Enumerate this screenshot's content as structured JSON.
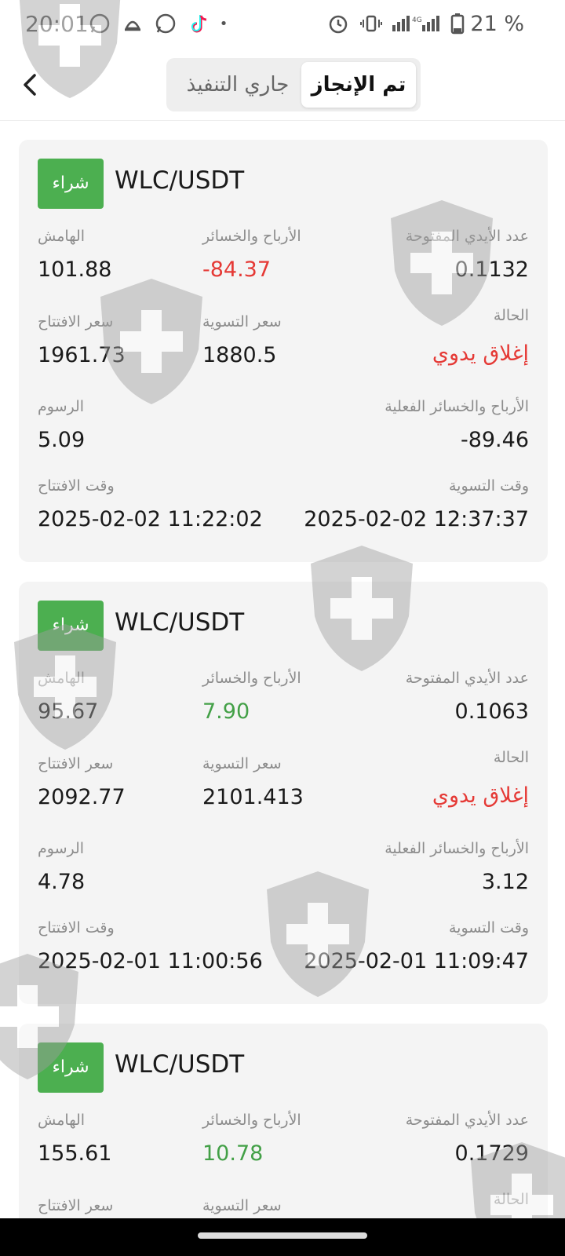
{
  "status_bar": {
    "time": "20:01",
    "battery_percent": "21 %",
    "network": "4G",
    "icons": [
      "whatsapp-icon",
      "notification-icon",
      "whatsapp-icon",
      "tiktok-icon",
      "dot-icon",
      "alarm-icon",
      "vibrate-icon",
      "signal-icon",
      "battery-icon"
    ]
  },
  "header": {
    "tabs": [
      {
        "label": "جاري التنفيذ",
        "active": false
      },
      {
        "label": "تم الإنجاز",
        "active": true
      }
    ]
  },
  "labels": {
    "margin": "الهامش",
    "pnl": "الأرباح والخسائر",
    "open_positions": "عدد الأيدي المفتوحة",
    "open_price": "سعر الافتتاح",
    "settle_price": "سعر التسوية",
    "status": "الحالة",
    "fees": "الرسوم",
    "real_pnl": "الأرباح والخسائر الفعلية",
    "open_time": "وقت الافتتاح",
    "settle_time": "وقت التسوية"
  },
  "trades": [
    {
      "side": "شراء",
      "pair": "WLC/USDT",
      "margin": "101.88",
      "pnl": "-84.37",
      "open_positions": "0.1132",
      "open_price": "1961.73",
      "settle_price": "1880.5",
      "status": "إغلاق يدوي",
      "fees": "5.09",
      "real_pnl": "-89.46",
      "open_time": "2025-02-02 11:22:02",
      "settle_time": "2025-02-02 12:37:37"
    },
    {
      "side": "شراء",
      "pair": "WLC/USDT",
      "margin": "95.67",
      "pnl": "7.90",
      "open_positions": "0.1063",
      "open_price": "2092.77",
      "settle_price": "2101.413",
      "status": "إغلاق يدوي",
      "fees": "4.78",
      "real_pnl": "3.12",
      "open_time": "2025-02-01 11:00:56",
      "settle_time": "2025-02-01 11:09:47"
    },
    {
      "side": "شراء",
      "pair": "WLC/USDT",
      "margin": "155.61",
      "pnl": "10.78",
      "open_positions": "0.1729",
      "open_price": "",
      "settle_price": "",
      "status": "",
      "fees": "",
      "real_pnl": "",
      "open_time": "",
      "settle_time": ""
    }
  ],
  "colors": {
    "buy": "#4caf50",
    "loss": "#e53935",
    "profit": "#43a047",
    "card_bg": "#f4f4f4"
  }
}
